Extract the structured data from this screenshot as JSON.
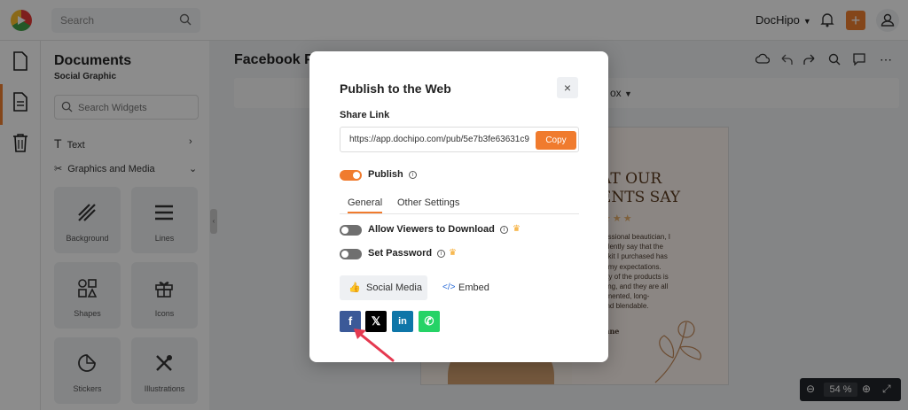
{
  "topbar": {
    "search_placeholder": "Search",
    "brand": "DocHipo",
    "plus": "+"
  },
  "panel": {
    "title": "Documents",
    "subtitle": "Social Graphic",
    "widget_search_placeholder": "Search Widgets",
    "text_label": "Text",
    "graphics_label": "Graphics and Media",
    "tiles": [
      "Background",
      "Lines",
      "Shapes",
      "Icons",
      "Stickers",
      "Illustrations"
    ]
  },
  "canvas": {
    "doc_title": "Facebook P",
    "fmt_text": "ox",
    "design": {
      "heading_line1": "AT OUR",
      "heading_line2": "ENTS SAY",
      "stars": "★★★",
      "body": "fessional beautician, I\nfidently say that the\np kit I purchased has\nd my expectations.\nility of the products is\nding, and they are all\ngmented, long-\nand blendable.",
      "name": "mne"
    },
    "zoom": "54 %"
  },
  "modal": {
    "title": "Publish to the Web",
    "close": "×",
    "share_link_label": "Share Link",
    "url": "https://app.dochipo.com/pub/5e7b3fe63631c9",
    "copy_label": "Copy",
    "publish_label": "Publish",
    "tabs": [
      "General",
      "Other Settings"
    ],
    "allow_download_label": "Allow Viewers to Download",
    "set_password_label": "Set Password",
    "social_media_label": "Social Media",
    "embed_label": "Embed",
    "social_buttons": [
      {
        "name": "facebook",
        "glyph": "f",
        "color": "#3b5998"
      },
      {
        "name": "x",
        "glyph": "𝕏",
        "color": "#000000"
      },
      {
        "name": "linkedin",
        "glyph": "in",
        "color": "#0e76a8"
      },
      {
        "name": "whatsapp",
        "glyph": "✆",
        "color": "#25d366"
      }
    ],
    "publish_on": true,
    "allow_download_on": false,
    "set_password_on": false
  },
  "colors": {
    "accent": "#f07b2e",
    "overlay": "rgba(0,0,0,0.45)",
    "annotation_arrow": "#e53950"
  }
}
